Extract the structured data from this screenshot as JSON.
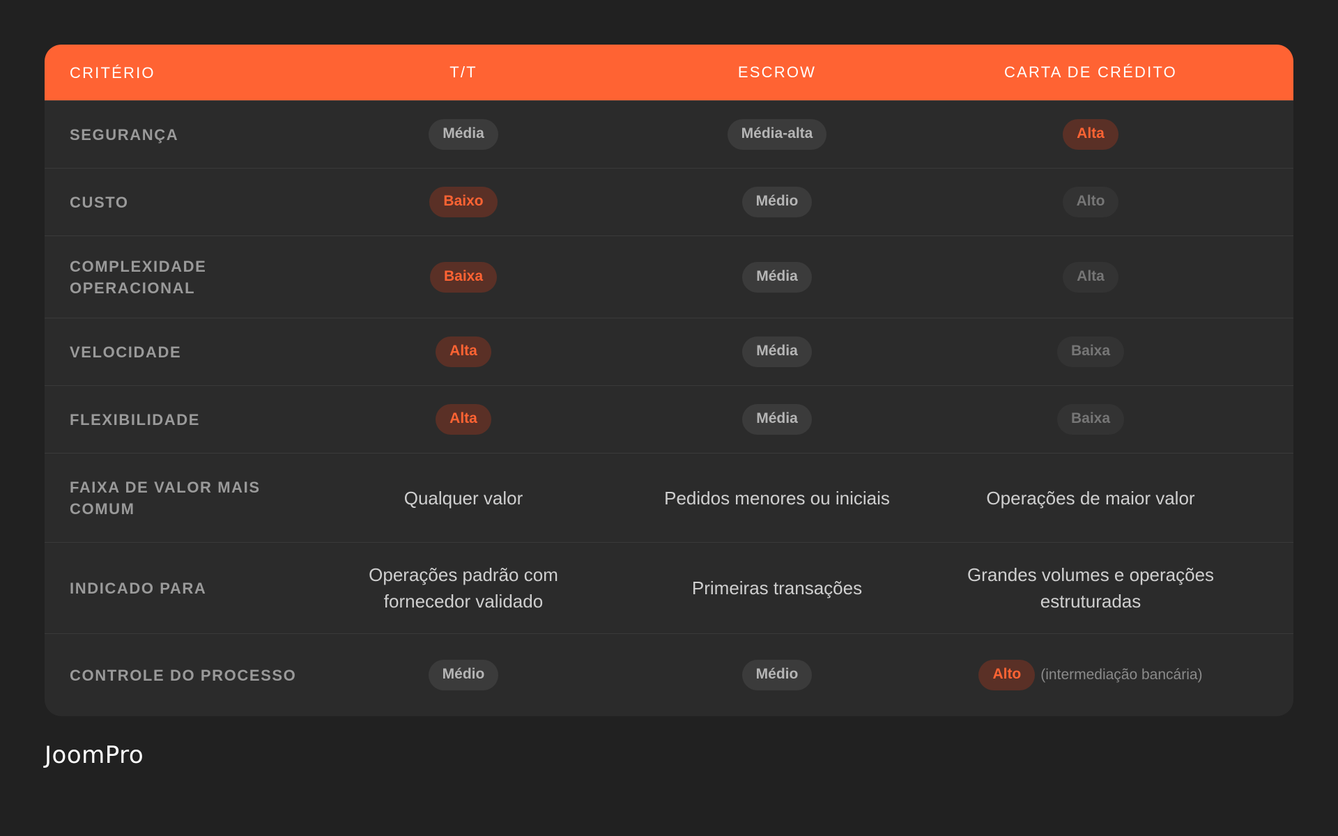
{
  "header": {
    "criterion": "CRITÉRIO",
    "col1": "T/T",
    "col2": "ESCROW",
    "col3": "CARTA DE CRÉDITO"
  },
  "rows": [
    {
      "label": "SEGURANÇA",
      "c1": "Média",
      "c2": "Média-alta",
      "c3": "Alta"
    },
    {
      "label": "CUSTO",
      "c1": "Baixo",
      "c2": "Médio",
      "c3": "Alto"
    },
    {
      "label": "COMPLEXIDADE OPERACIONAL",
      "c1": "Baixa",
      "c2": "Média",
      "c3": "Alta"
    },
    {
      "label": "VELOCIDADE",
      "c1": "Alta",
      "c2": "Média",
      "c3": "Baixa"
    },
    {
      "label": "FLEXIBILIDADE",
      "c1": "Alta",
      "c2": "Média",
      "c3": "Baixa"
    },
    {
      "label": "FAIXA DE VALOR MAIS COMUM",
      "c1": "Qualquer valor",
      "c2": "Pedidos menores ou iniciais",
      "c3": "Operações de maior valor"
    },
    {
      "label": "INDICADO PARA",
      "c1": "Operações padrão com fornecedor validado",
      "c2": "Primeiras transações",
      "c3": "Grandes volumes e operações estruturadas"
    },
    {
      "label": "CONTROLE DO PROCESSO",
      "c1": "Médio",
      "c2": "Médio",
      "c3": "Alto",
      "c3_note": "(intermediação bancária)"
    }
  ],
  "colors": {
    "accent": "#ff6333",
    "background": "#212121",
    "table_bg": "#2b2b2b"
  },
  "brand": {
    "logo": "JoomPro"
  }
}
